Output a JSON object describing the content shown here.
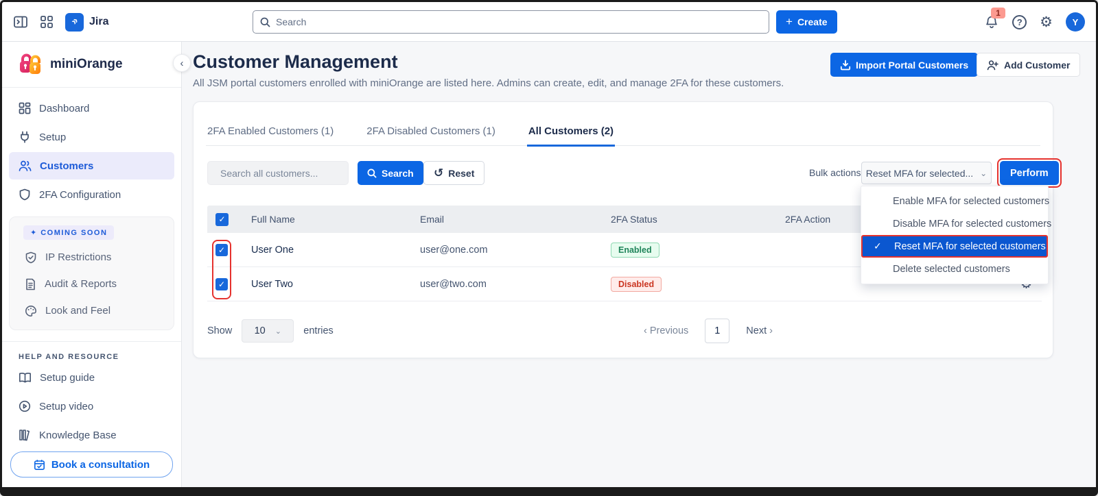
{
  "topbar": {
    "app_name": "Jira",
    "search_placeholder": "Search",
    "create_label": "Create",
    "notification_count": "1",
    "avatar_initial": "Y",
    "help_glyph": "?"
  },
  "sidebar": {
    "brand": "miniOrange",
    "items": [
      {
        "label": "Dashboard"
      },
      {
        "label": "Setup"
      },
      {
        "label": "Customers",
        "active": true
      },
      {
        "label": "2FA Configuration"
      }
    ],
    "coming_soon": {
      "badge": "COMING SOON",
      "items": [
        {
          "label": "IP Restrictions"
        },
        {
          "label": "Audit & Reports"
        },
        {
          "label": "Look and Feel"
        }
      ]
    },
    "help_section": {
      "title": "HELP AND RESOURCE",
      "items": [
        {
          "label": "Setup guide"
        },
        {
          "label": "Setup video"
        },
        {
          "label": "Knowledge Base"
        }
      ],
      "cta": "Book a consultation"
    }
  },
  "main": {
    "title": "Customer Management",
    "subtitle": "All JSM portal customers enrolled with miniOrange are listed here. Admins can create, edit, and manage 2FA for these customers.",
    "import_button": "Import Portal Customers",
    "add_button": "Add Customer",
    "tabs": [
      {
        "label": "2FA Enabled Customers (1)"
      },
      {
        "label": "2FA Disabled Customers (1)"
      },
      {
        "label": "All Customers (2)",
        "active": true
      }
    ],
    "controls": {
      "search_placeholder": "Search all customers...",
      "search_button": "Search",
      "reset_button": "Reset",
      "bulk_label": "Bulk actions:",
      "bulk_selected": "Reset MFA for selected...",
      "perform_button": "Perform"
    },
    "table": {
      "headers": {
        "name": "Full Name",
        "email": "Email",
        "status": "2FA Status",
        "action": "2FA Action"
      },
      "rows": [
        {
          "name": "User One",
          "email": "user@one.com",
          "status": "Enabled",
          "toggle": "on",
          "checked": true
        },
        {
          "name": "User Two",
          "email": "user@two.com",
          "status": "Disabled",
          "toggle": "off",
          "checked": true
        }
      ]
    },
    "bulk_menu": {
      "items": [
        {
          "label": "Enable MFA for selected customers"
        },
        {
          "label": "Disable MFA for selected customers"
        },
        {
          "label": "Reset MFA for selected customers",
          "selected": true
        },
        {
          "label": "Delete selected customers"
        }
      ]
    },
    "pagination": {
      "show_label": "Show",
      "page_size": "10",
      "entries_label": "entries",
      "previous": "Previous",
      "page": "1",
      "next": "Next"
    }
  },
  "colors": {
    "accent_blue": "#0C66E4",
    "selected_menu_blue": "#0B57D0",
    "annotation_red": "#E5322E",
    "toggle_on_green": "#679324",
    "toggle_off_dark": "#2B2B2B",
    "badge_enabled_text": "#1F845A",
    "badge_disabled_text": "#CA3521",
    "active_nav_bg": "#EBEBFB"
  }
}
